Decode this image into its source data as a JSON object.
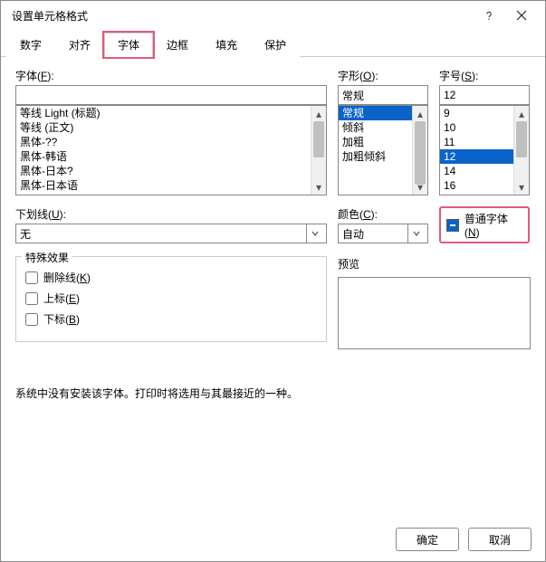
{
  "window": {
    "title": "设置单元格格式"
  },
  "tabs": [
    "数字",
    "对齐",
    "字体",
    "边框",
    "填充",
    "保护"
  ],
  "active_tab_index": 2,
  "font": {
    "label": "字体(F):",
    "value": "",
    "options": [
      "等线 Light (标题)",
      "等线 (正文)",
      "黑体-??",
      "黑体-韩语",
      "黑体-日本?",
      "黑体-日本语"
    ]
  },
  "style": {
    "label": "字形(O):",
    "value": "常规",
    "options": [
      "常规",
      "倾斜",
      "加粗",
      "加粗倾斜"
    ],
    "selected_index": 0
  },
  "size": {
    "label": "字号(S):",
    "value": "12",
    "options": [
      "9",
      "10",
      "11",
      "12",
      "14",
      "16"
    ],
    "selected_index": 3
  },
  "underline": {
    "label": "下划线(U):",
    "value": "无"
  },
  "color": {
    "label": "颜色(C):",
    "value": "自动"
  },
  "normal_font": {
    "label": "普通字体(N)",
    "checked": true
  },
  "effects": {
    "legend": "特殊效果",
    "strike": "删除线(K)",
    "superscript": "上标(E)",
    "subscript": "下标(B)"
  },
  "preview": {
    "label": "预览"
  },
  "note": "系统中没有安装该字体。打印时将选用与其最接近的一种。",
  "buttons": {
    "ok": "确定",
    "cancel": "取消"
  }
}
